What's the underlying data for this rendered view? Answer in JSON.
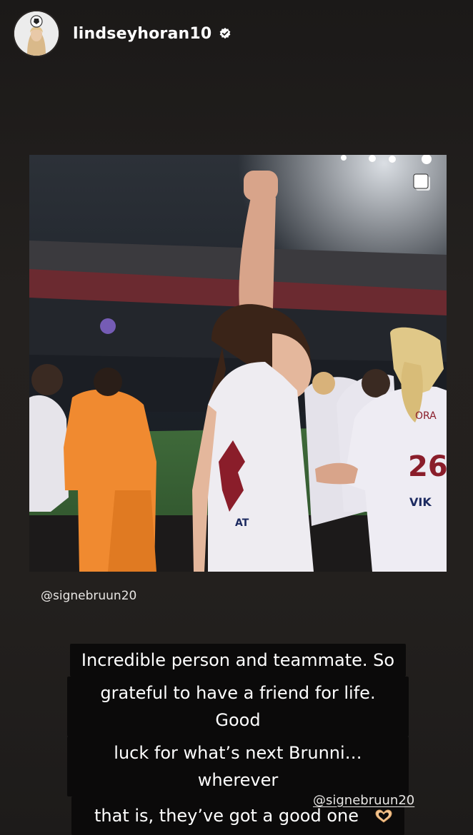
{
  "header": {
    "username": "lindseyhoran10",
    "avatar_icon": "profile-avatar",
    "verified_icon": "verified-badge-icon"
  },
  "post": {
    "multi_image_icon": "carousel-icon",
    "mention": "@signebruun20"
  },
  "caption": {
    "lines": [
      "Incredible person and teammate. So",
      "grateful to have a friend for life. Good",
      "luck for what’s next Brunni… wherever",
      "that is, they’ve got a good one"
    ],
    "emoji": "heart-hands-emoji"
  },
  "mention_sticker": "@signebruun20",
  "colors": {
    "background": "#23201e",
    "sticker_bg": "#0b0a0a",
    "text": "#ffffff",
    "kit_red": "#8a1d2a",
    "keeper_orange": "#f08a30"
  }
}
